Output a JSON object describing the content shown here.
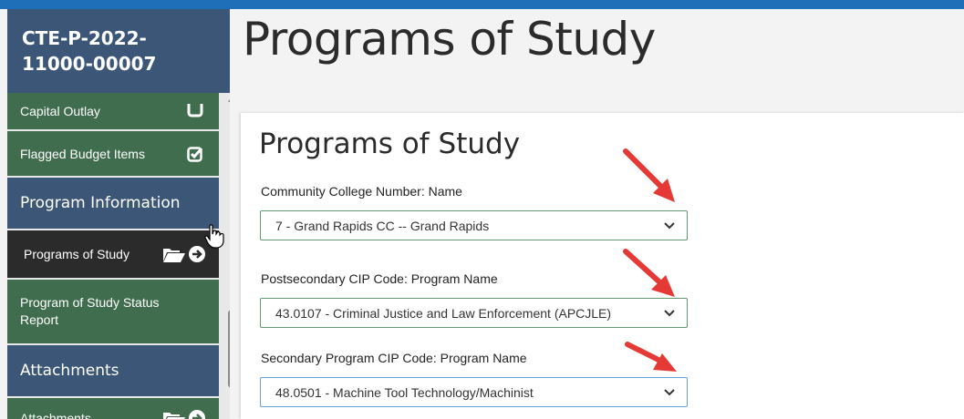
{
  "sidebar": {
    "header": "CTE-P-2022-11000-00007",
    "items": [
      {
        "label": "Capital Outlay",
        "icon": "checkbox-icon"
      },
      {
        "label": "Flagged Budget Items",
        "icon": "checked-checkbox-icon"
      },
      {
        "label": "Program Information"
      },
      {
        "label": "Programs of Study",
        "icon": "folder-arrow-icon",
        "active": true
      },
      {
        "label": "Program of Study Status Report"
      },
      {
        "label": "Attachments"
      },
      {
        "label": "Attachments",
        "icon": "folder-arrow-icon"
      }
    ]
  },
  "main": {
    "page_title": "Programs of Study",
    "card_title": "Programs of Study",
    "fields": [
      {
        "label": "Community College Number: Name",
        "value": "7 - Grand Rapids CC -- Grand Rapids"
      },
      {
        "label": "Postsecondary CIP Code: Program Name",
        "value": "43.0107 - Criminal Justice and Law Enforcement (APCJLE)"
      },
      {
        "label": "Secondary Program CIP Code: Program Name",
        "value": "48.0501 - Machine Tool Technology/Machinist"
      }
    ]
  },
  "colors": {
    "top_bar": "#1e6fb8",
    "sidebar_blue": "#3b5676",
    "sidebar_green": "#3f6d4e",
    "sidebar_active": "#2b2b2b",
    "annotation_arrow": "#e53935"
  }
}
